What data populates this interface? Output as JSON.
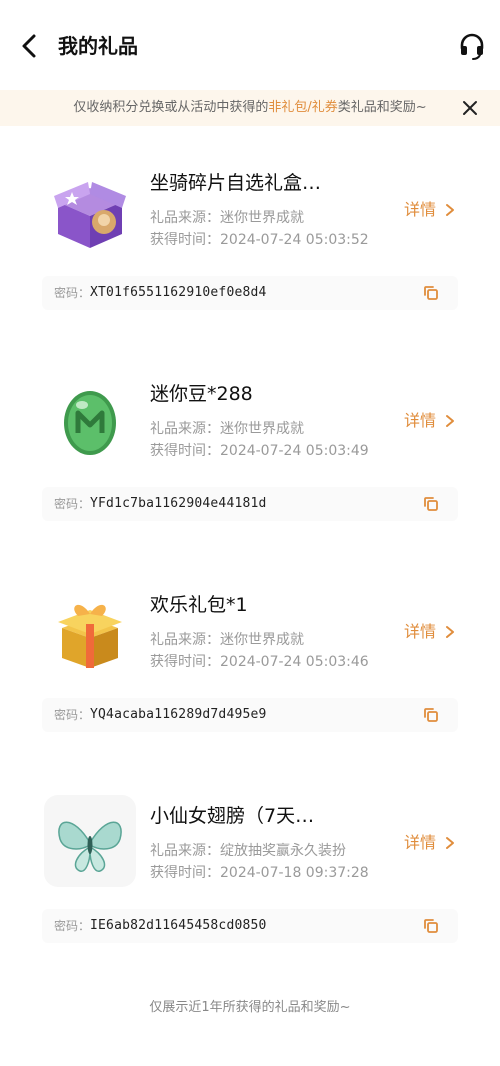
{
  "header": {
    "title": "我的礼品",
    "back_icon": "chevron-left-icon",
    "service_icon": "headset-icon"
  },
  "notice": {
    "text_before": "仅收纳积分兑换或从活动中获得的",
    "highlight": "非礼包/礼券",
    "text_after": "类礼品和奖励~",
    "close_icon": "close-icon",
    "highlight_color": "#e08d3c",
    "background": "#fdf6ec"
  },
  "gifts": [
    {
      "name": "坐骑碎片自选礼盒…",
      "source": "礼品来源：迷你世界成就",
      "time": "获得时间：2024-07-24 05:03:52",
      "detail_label": "详情",
      "code_label": "密码：",
      "code": "XT01f6551162910ef0e8d4",
      "icon": "purple-gift-box-icon"
    },
    {
      "name": "迷你豆*288",
      "source": "礼品来源：迷你世界成就",
      "time": "获得时间：2024-07-24 05:03:49",
      "detail_label": "详情",
      "code_label": "密码：",
      "code": "YFd1c7ba1162904e44181d",
      "icon": "green-bean-icon"
    },
    {
      "name": "欢乐礼包*1",
      "source": "礼品来源：迷你世界成就",
      "time": "获得时间：2024-07-24 05:03:46",
      "detail_label": "详情",
      "code_label": "密码：",
      "code": "YQ4acaba116289d7d495e9",
      "icon": "gold-gift-box-icon"
    },
    {
      "name": "小仙女翅膀（7天…",
      "source": "礼品来源：绽放抽奖赢永久装扮",
      "time": "获得时间：2024-07-18 09:37:28",
      "detail_label": "详情",
      "code_label": "密码：",
      "code": "IE6ab82d11645458cd0850",
      "icon": "fairy-wings-icon"
    }
  ],
  "footer": {
    "note": "仅展示近1年所获得的礼品和奖励~"
  },
  "colors": {
    "accent": "#e08d3c",
    "muted_text": "#9a9a9a"
  }
}
